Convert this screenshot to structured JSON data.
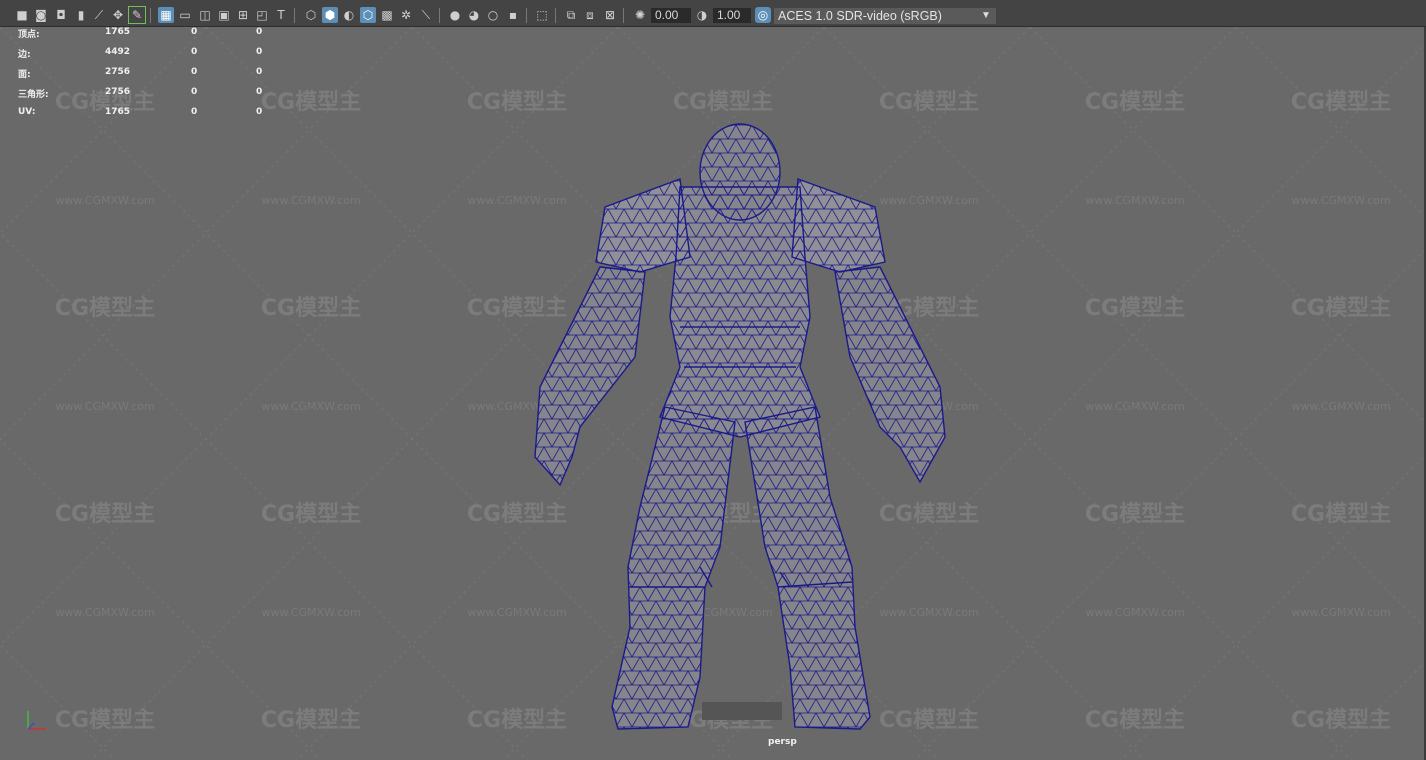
{
  "toolbar": {
    "exposure_value": "0.00",
    "gamma_value": "1.00",
    "color_space": "ACES 1.0 SDR-video (sRGB)"
  },
  "hud": {
    "rows": [
      {
        "label": "顶点:",
        "a": "1765",
        "b": "0",
        "c": "0"
      },
      {
        "label": "边:",
        "a": "4492",
        "b": "0",
        "c": "0"
      },
      {
        "label": "面:",
        "a": "2756",
        "b": "0",
        "c": "0"
      },
      {
        "label": "三角形:",
        "a": "2756",
        "b": "0",
        "c": "0"
      },
      {
        "label": "UV:",
        "a": "1765",
        "b": "0",
        "c": "0"
      }
    ]
  },
  "viewport": {
    "camera": "persp",
    "watermark_logo": "CG模型主",
    "watermark_url": "www.CGMXW.com"
  },
  "colors": {
    "wireframe": "#1a1a8a",
    "mesh_fill": "#8a8a90",
    "viewport_bg": "#696969",
    "toolbar_bg": "#444444",
    "active_icon": "#5c8fb8"
  }
}
